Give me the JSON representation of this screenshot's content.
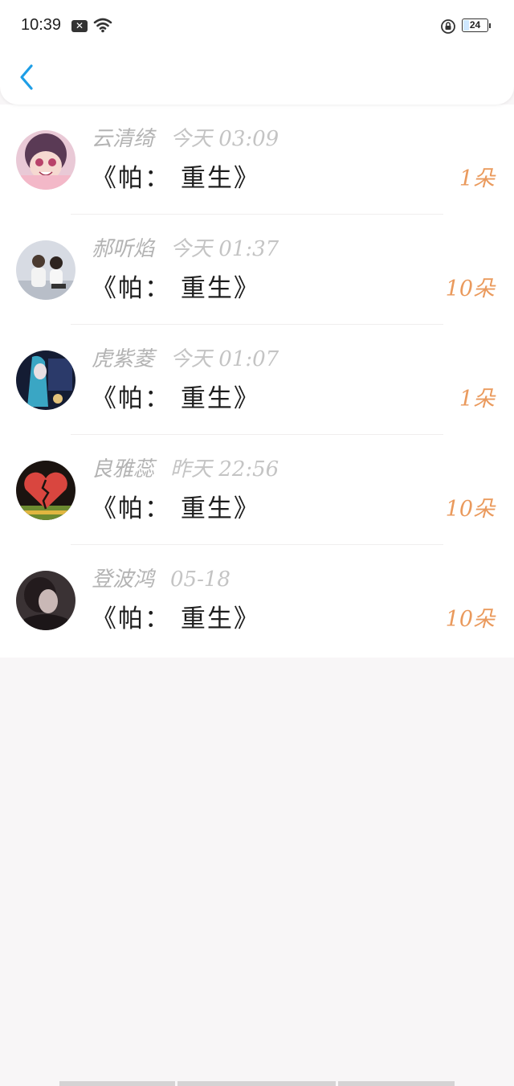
{
  "status_bar": {
    "time": "10:39",
    "notification_icon": "x-box-icon",
    "wifi_icon": "wifi-icon",
    "lock_icon": "rotation-lock-icon",
    "battery_level": "24",
    "battery_fraction": 0.24
  },
  "nav": {
    "back_icon": "chevron-left-icon",
    "accent_color": "#1e9ee6"
  },
  "rows": [
    {
      "user": "云清绮",
      "time": "今天 03:09",
      "book": "《帕： 重生》",
      "flowers": "1朵",
      "avatar": "anime-girl-avatar"
    },
    {
      "user": "郝听焰",
      "time": "今天 01:37",
      "book": "《帕： 重生》",
      "flowers": "10朵",
      "avatar": "couple-photo-avatar"
    },
    {
      "user": "虎紫菱",
      "time": "今天 01:07",
      "book": "《帕： 重生》",
      "flowers": "1朵",
      "avatar": "dark-anime-avatar"
    },
    {
      "user": "良雅蕊",
      "time": "昨天 22:56",
      "book": "《帕： 重生》",
      "flowers": "10朵",
      "avatar": "broken-heart-avatar"
    },
    {
      "user": "登波鸿",
      "time": "05-18",
      "book": "《帕： 重生》",
      "flowers": "10朵",
      "avatar": "dark-portrait-avatar"
    }
  ],
  "colors": {
    "flowers": "#ea9a5d",
    "username": "#b3b3b3",
    "book": "#1e1e1e",
    "background": "#f8f6f7"
  }
}
